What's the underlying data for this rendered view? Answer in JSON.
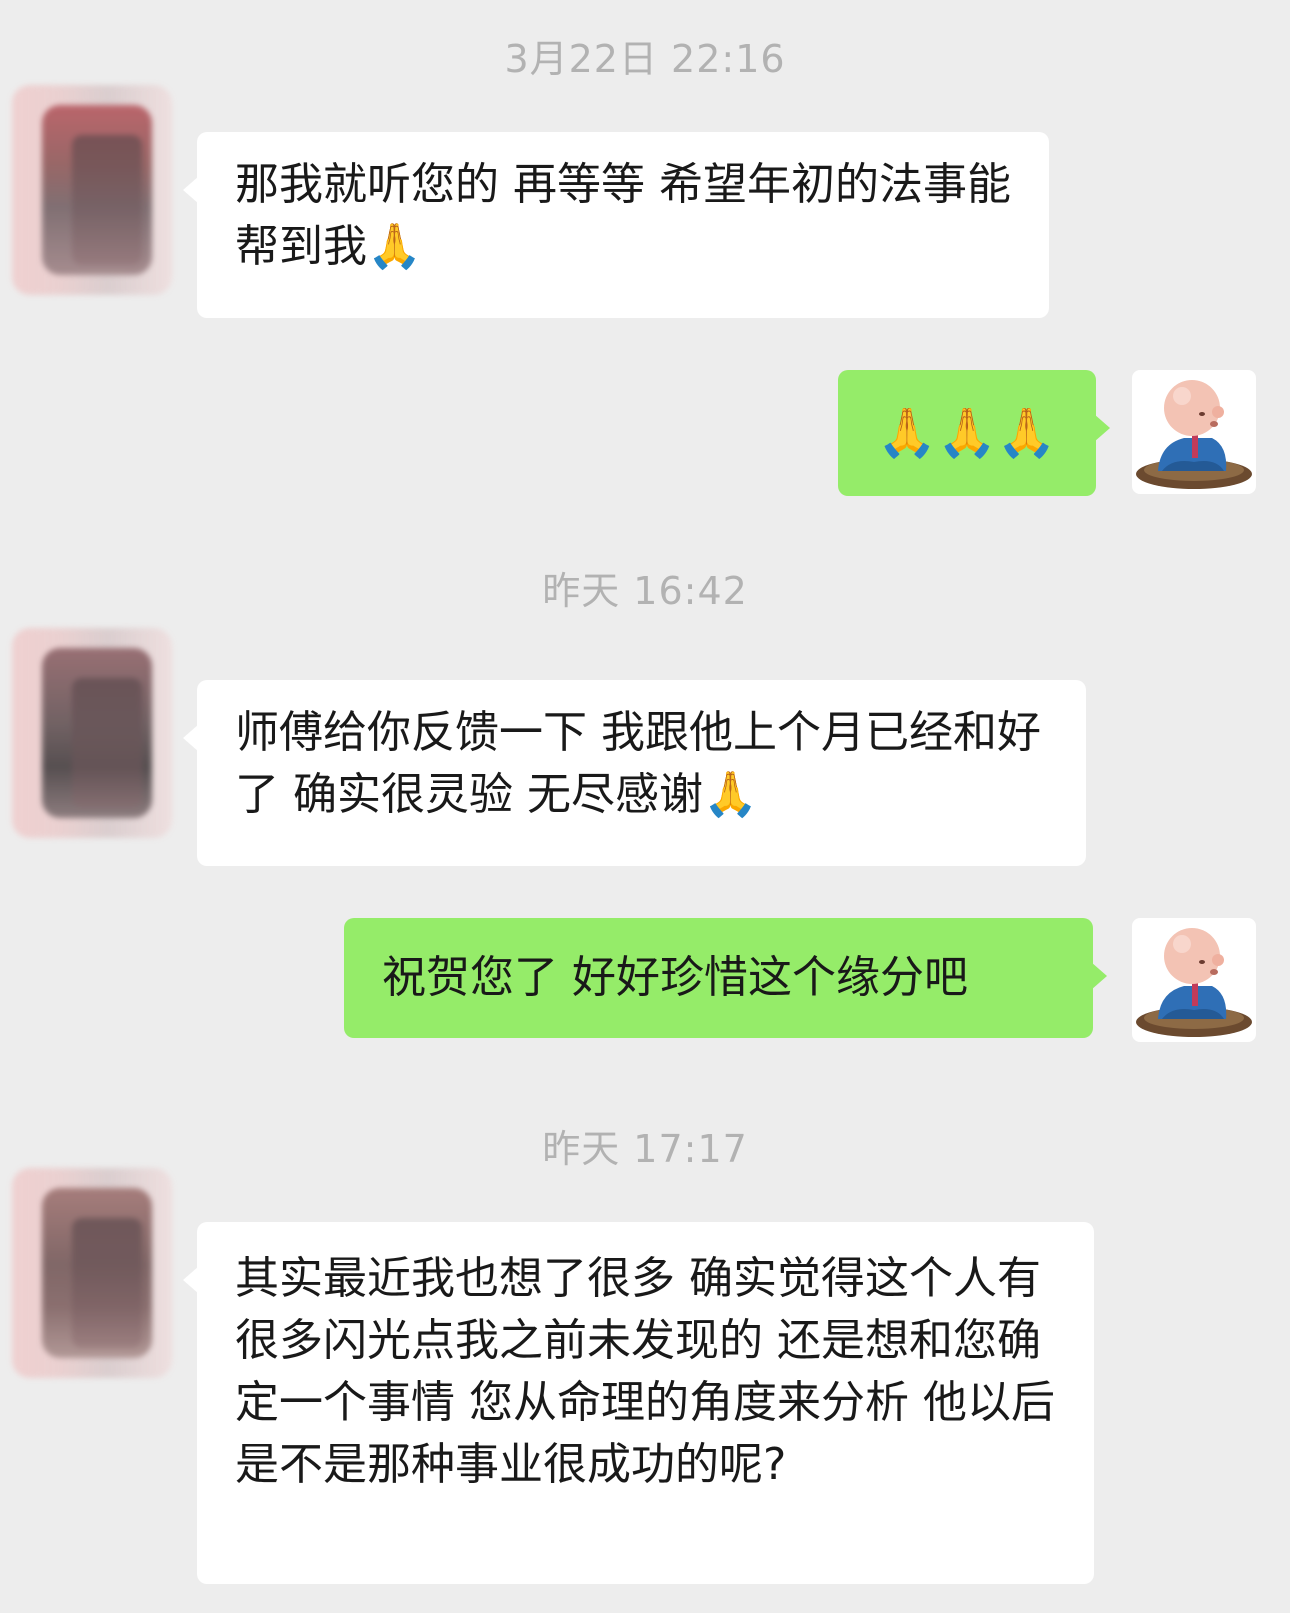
{
  "messages": [
    {
      "type": "timestamp",
      "text": "3月22日 22:16"
    },
    {
      "type": "incoming",
      "text": "那我就听您的 再等等 希望年初的法事能帮到我🙏"
    },
    {
      "type": "outgoing",
      "text": "🙏🙏🙏"
    },
    {
      "type": "timestamp",
      "text": "昨天 16:42"
    },
    {
      "type": "incoming",
      "text": "师傅给你反馈一下 我跟他上个月已经和好了 确实很灵验 无尽感谢🙏"
    },
    {
      "type": "outgoing",
      "text": "祝贺您了 好好珍惜这个缘分吧"
    },
    {
      "type": "timestamp",
      "text": "昨天 17:17"
    },
    {
      "type": "incoming",
      "text": "其实最近我也想了很多 确实觉得这个人有很多闪光点我之前未发现的 还是想和您确定一个事情 您从命理的角度来分析 他以后是不是那种事业很成功的呢?"
    }
  ],
  "avatars": {
    "contact": "blurred-avatar",
    "self": "bald-monk-figure"
  },
  "colors": {
    "background": "#ededed",
    "incoming_bubble": "#ffffff",
    "outgoing_bubble": "#95ec69",
    "timestamp": "#b2b2b2"
  }
}
